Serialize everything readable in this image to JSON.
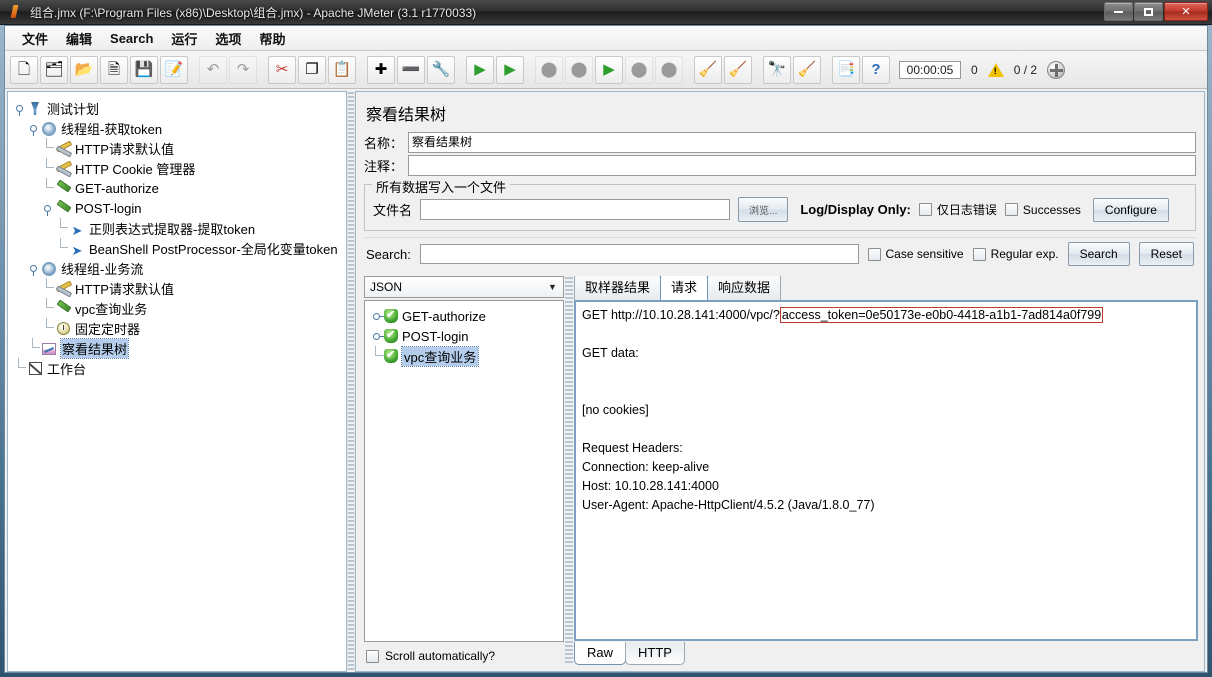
{
  "window": {
    "title": "组合.jmx (F:\\Program Files (x86)\\Desktop\\组合.jmx) - Apache JMeter (3.1 r1770033)",
    "minimize_label": "",
    "maximize_label": "",
    "close_label": "✕"
  },
  "menu": {
    "items": [
      "文件",
      "编辑",
      "Search",
      "运行",
      "选项",
      "帮助"
    ]
  },
  "toolbar": {
    "buttons": [
      {
        "name": "new-icon",
        "glyph": "🗋",
        "disabled": false
      },
      {
        "name": "templates-icon",
        "glyph": "🗂",
        "disabled": false
      },
      {
        "name": "open-icon",
        "glyph": "📂",
        "disabled": false
      },
      {
        "name": "close-icon",
        "glyph": "🗎",
        "disabled": false
      },
      {
        "name": "save-icon",
        "glyph": "💾",
        "disabled": false
      },
      {
        "name": "save-as-icon",
        "glyph": "📝",
        "disabled": false
      },
      {
        "name": "undo-icon",
        "glyph": "↶",
        "disabled": true
      },
      {
        "name": "redo-icon",
        "glyph": "↷",
        "disabled": true
      },
      {
        "name": "cut-icon",
        "glyph": "✂",
        "disabled": false
      },
      {
        "name": "copy-icon",
        "glyph": "❐",
        "disabled": false
      },
      {
        "name": "paste-icon",
        "glyph": "📋",
        "disabled": false
      },
      {
        "name": "expand-all-icon",
        "glyph": "✚",
        "disabled": false
      },
      {
        "name": "collapse-all-icon",
        "glyph": "➖",
        "disabled": false
      },
      {
        "name": "toggle-icon",
        "glyph": "🔧",
        "disabled": false
      },
      {
        "name": "start-icon",
        "glyph": "▶",
        "disabled": false
      },
      {
        "name": "start-no-pause-icon",
        "glyph": "▶",
        "disabled": false
      },
      {
        "name": "stop-icon",
        "glyph": "⬤",
        "disabled": true
      },
      {
        "name": "shutdown-icon",
        "glyph": "⬤",
        "disabled": true
      },
      {
        "name": "remote-start-icon",
        "glyph": "▶",
        "disabled": false
      },
      {
        "name": "remote-stop-icon",
        "glyph": "⬤",
        "disabled": true
      },
      {
        "name": "remote-shutdown-icon",
        "glyph": "⬤",
        "disabled": true
      },
      {
        "name": "clear-icon",
        "glyph": "🧹",
        "disabled": false
      },
      {
        "name": "clear-all-icon",
        "glyph": "🧹",
        "disabled": false
      },
      {
        "name": "search-icon",
        "glyph": "🔭",
        "disabled": false
      },
      {
        "name": "search-reset-icon",
        "glyph": "🧹",
        "disabled": false
      },
      {
        "name": "function-helper-icon",
        "glyph": "📑",
        "disabled": false
      },
      {
        "name": "help-icon",
        "glyph": "?",
        "disabled": false
      }
    ],
    "elapsed_time": "00:00:05",
    "warning_count": "0",
    "thread_counts": "0 / 2"
  },
  "tree": {
    "nodes": [
      {
        "label": "测试计划",
        "icon": "test-plan-icon",
        "depth": 0,
        "handle": true,
        "selected": false
      },
      {
        "label": "线程组-获取token",
        "icon": "thread-group-icon",
        "depth": 1,
        "handle": true,
        "selected": false
      },
      {
        "label": "HTTP请求默认值",
        "icon": "config-icon",
        "depth": 2,
        "handle": false,
        "selected": false
      },
      {
        "label": "HTTP Cookie 管理器",
        "icon": "config-icon",
        "depth": 2,
        "handle": false,
        "selected": false
      },
      {
        "label": "GET-authorize",
        "icon": "sampler-icon",
        "depth": 2,
        "handle": false,
        "selected": false
      },
      {
        "label": "POST-login",
        "icon": "sampler-icon",
        "depth": 2,
        "handle": true,
        "selected": false
      },
      {
        "label": "正则表达式提取器-提取token",
        "icon": "post-processor-icon",
        "depth": 3,
        "handle": false,
        "selected": false
      },
      {
        "label": "BeanShell PostProcessor-全局化变量token",
        "icon": "post-processor-icon",
        "depth": 3,
        "handle": false,
        "selected": false
      },
      {
        "label": "线程组-业务流",
        "icon": "thread-group-icon",
        "depth": 1,
        "handle": true,
        "selected": false
      },
      {
        "label": "HTTP请求默认值",
        "icon": "config-icon",
        "depth": 2,
        "handle": false,
        "selected": false
      },
      {
        "label": "vpc查询业务",
        "icon": "sampler-icon",
        "depth": 2,
        "handle": false,
        "selected": false
      },
      {
        "label": "固定定时器",
        "icon": "timer-icon",
        "depth": 2,
        "handle": false,
        "selected": false
      },
      {
        "label": "察看结果树",
        "icon": "view-results-tree-icon",
        "depth": 1,
        "handle": false,
        "selected": true
      },
      {
        "label": "工作台",
        "icon": "workbench-icon",
        "depth": 0,
        "handle": false,
        "selected": false
      }
    ]
  },
  "panel": {
    "title": "察看结果树",
    "name_label": "名称：",
    "name_value": "察看结果树",
    "comment_label": "注释：",
    "comment_value": "",
    "file_group_title": "所有数据写入一个文件",
    "filename_label": "文件名",
    "filename_value": "",
    "browse_label": "浏览...",
    "log_display_label": "Log/Display Only:",
    "errors_only_label": "仅日志错误",
    "successes_label": "Successes",
    "configure_label": "Configure",
    "search_label": "Search:",
    "search_value": "",
    "case_sensitive_label": "Case sensitive",
    "regular_exp_label": "Regular exp.",
    "search_button_label": "Search",
    "reset_button_label": "Reset"
  },
  "results": {
    "renderer_selected": "JSON",
    "items": [
      {
        "label": "GET-authorize",
        "status": "success",
        "expandable": true,
        "selected": false
      },
      {
        "label": "POST-login",
        "status": "success",
        "expandable": true,
        "selected": false
      },
      {
        "label": "vpc查询业务",
        "status": "success",
        "expandable": false,
        "selected": true
      }
    ],
    "scroll_automatically_label": "Scroll automatically?"
  },
  "detail": {
    "tabs": [
      {
        "label": "取样器结果",
        "active": false
      },
      {
        "label": "请求",
        "active": true
      },
      {
        "label": "响应数据",
        "active": false
      }
    ],
    "request_prefix": "GET http://10.10.28.141:4000/vpc/?",
    "request_highlight": "access_token=0e50173e-e0b0-4418-a1b1-7ad814a0f799",
    "lines": [
      "",
      "GET data:",
      "",
      "",
      "[no cookies]",
      "",
      "Request Headers:",
      "Connection: keep-alive",
      "Host: 10.10.28.141:4000",
      "User-Agent: Apache-HttpClient/4.5.2 (Java/1.8.0_77)"
    ],
    "bottom_tabs": [
      {
        "label": "Raw",
        "active": true
      },
      {
        "label": "HTTP",
        "active": false
      }
    ]
  },
  "colors": {
    "accent": "#3b6fa8",
    "highlight_border": "#c0392b",
    "selection": "#b3cdea",
    "success": "#3ba12c"
  }
}
